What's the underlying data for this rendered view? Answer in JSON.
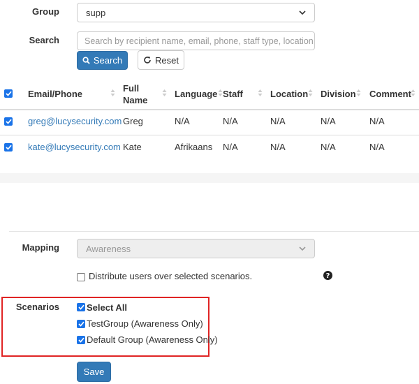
{
  "filters": {
    "group_label": "Group",
    "group_value": "supp",
    "search_label": "Search",
    "search_placeholder": "Search by recipient name, email, phone, staff type, location, d",
    "search_button": "Search",
    "reset_button": "Reset"
  },
  "table": {
    "headers": [
      "Email/Phone",
      "Full Name",
      "Language",
      "Staff",
      "Location",
      "Division",
      "Comment"
    ],
    "rows": [
      {
        "email": "greg@lucysecurity.com",
        "name": "Greg",
        "language": "N/A",
        "staff": "N/A",
        "location": "N/A",
        "division": "N/A",
        "comment": "N/A",
        "checked": true
      },
      {
        "email": "kate@lucysecurity.com",
        "name": "Kate",
        "language": "Afrikaans",
        "staff": "N/A",
        "location": "N/A",
        "division": "N/A",
        "comment": "N/A",
        "checked": true
      }
    ]
  },
  "mapping": {
    "label": "Mapping",
    "value": "Awareness",
    "distribute_label": "Distribute users over selected scenarios."
  },
  "scenarios": {
    "label": "Scenarios",
    "select_all": "Select All",
    "items": [
      {
        "label": "TestGroup (Awareness Only)",
        "checked": true
      },
      {
        "label": "Default Group (Awareness Only)",
        "checked": true
      }
    ],
    "highlight_color": "#e02424"
  },
  "save_button": "Save",
  "colors": {
    "primary": "#337ab7",
    "checkbox": "#1a73e8",
    "link": "#337ab7"
  }
}
